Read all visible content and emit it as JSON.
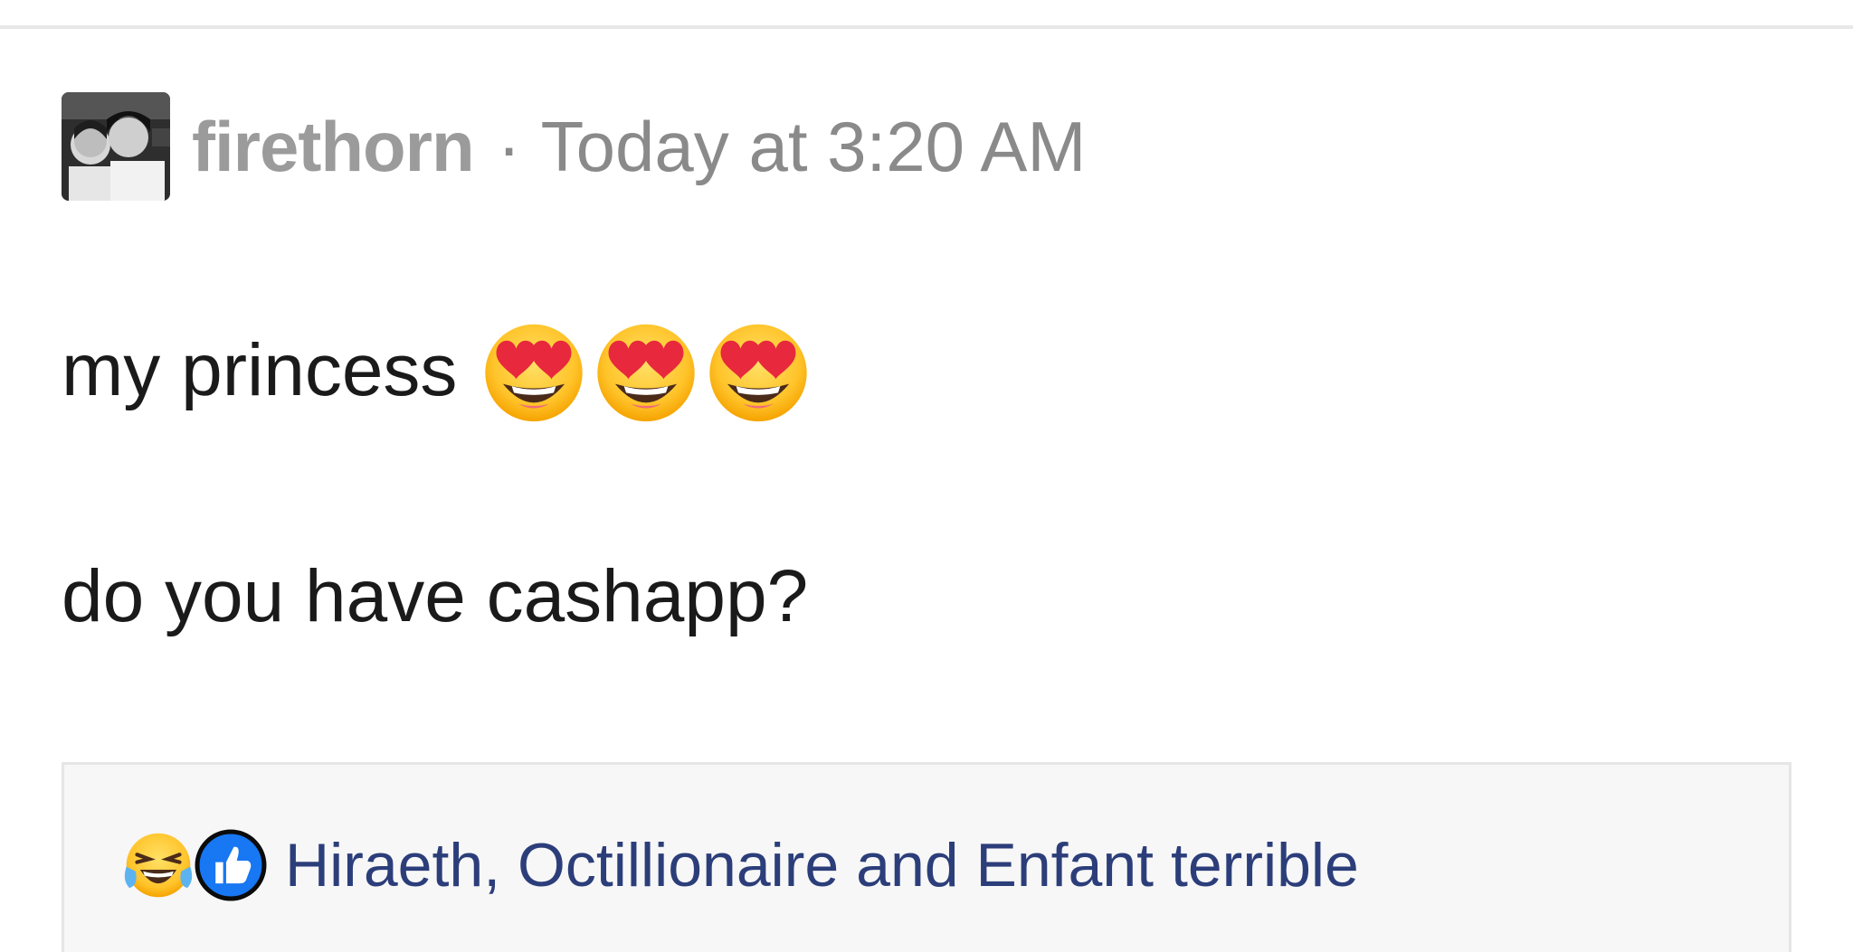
{
  "post": {
    "author": "firethorn",
    "separator": "·",
    "timestamp": "Today at 3:20 AM",
    "avatar_icon": "user-photo-avatar"
  },
  "message": {
    "line1_text": "my princess",
    "line1_emojis": [
      "heart-eyes-emoji",
      "heart-eyes-emoji",
      "heart-eyes-emoji"
    ],
    "line2_text": "do you have cashapp?"
  },
  "reactions": {
    "icons": [
      "laughing-tears-icon",
      "thumbs-up-icon"
    ],
    "reactors_text": "Hiraeth, Octillionaire and Enfant terrible"
  },
  "colors": {
    "author": "#9b9b9b",
    "timestamp": "#8a8a8a",
    "body_text": "#1a1a1a",
    "reactors_link": "#2c3e7a",
    "reaction_box_bg": "#f7f7f7",
    "emoji_yellow": "#ffcc33",
    "heart_red": "#e8283c",
    "like_blue": "#1877f2"
  }
}
